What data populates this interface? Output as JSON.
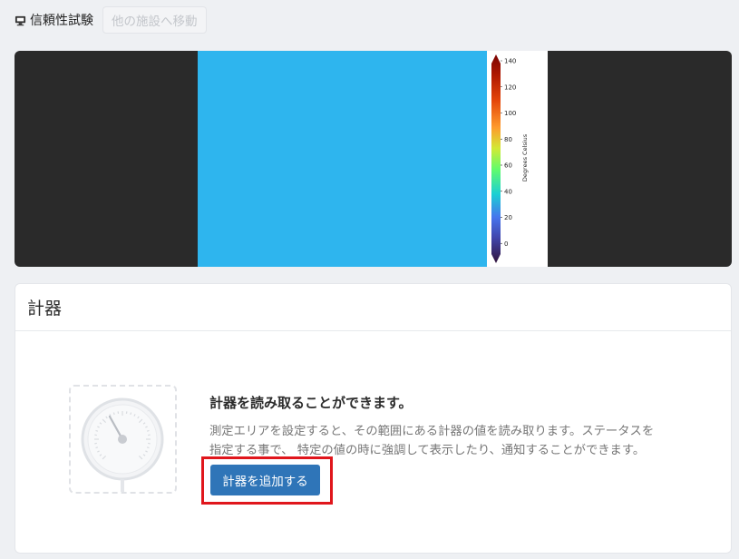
{
  "header": {
    "facility_name": "信頼性試験",
    "move_facility_label": "他の施設へ移動",
    "facility_icon": "monitor-icon"
  },
  "camera": {
    "colors": {
      "background": "#2a2a2a",
      "thermal_fill": "#2eb5ee"
    },
    "colorbar": {
      "label": "Degrees Celsius",
      "ticks": [
        "140",
        "120",
        "100",
        "80",
        "60",
        "40",
        "20",
        "0"
      ]
    }
  },
  "gauges_card": {
    "title": "計器",
    "empty_title": "計器を読み取ることができます。",
    "empty_description_line1": "測定エリアを設定すると、その範囲にある計器の値を読み取ります。ステータスを",
    "empty_description_line2": "指定する事で、 特定の値の時に強調して表示したり、通知することができます。",
    "add_button_label": "計器を追加する",
    "illustration_icon": "gauge-icon",
    "colors": {
      "button": "#2f75b8",
      "highlight": "#e0161c"
    }
  }
}
